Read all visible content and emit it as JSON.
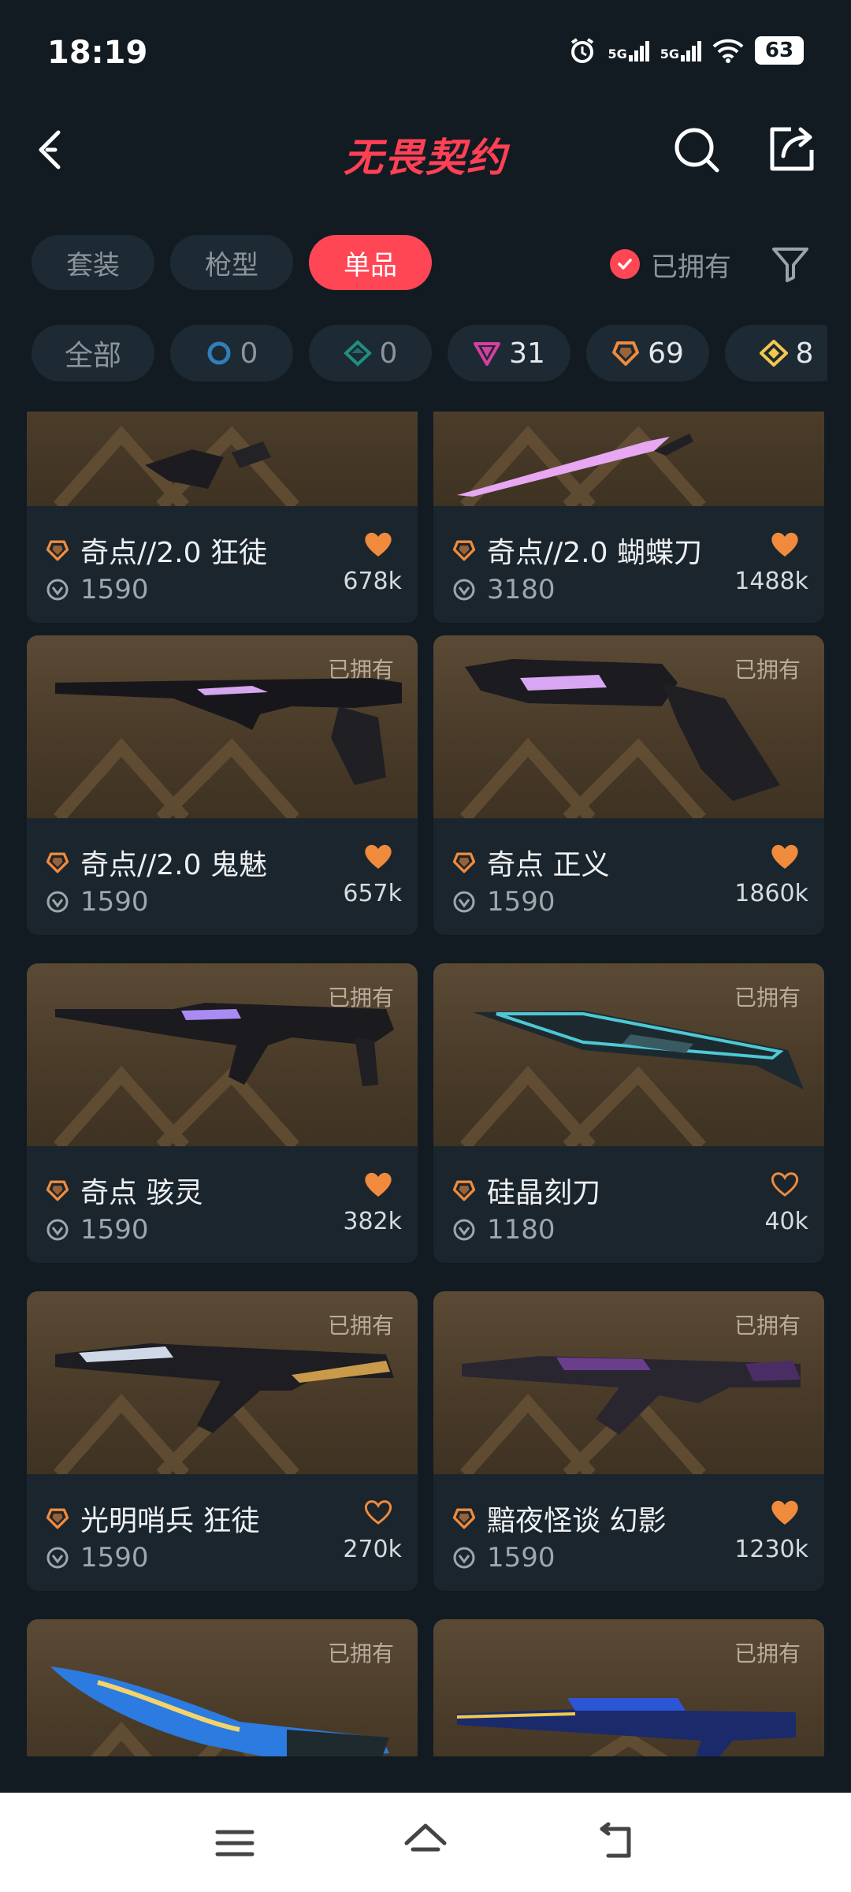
{
  "status": {
    "time": "18:19",
    "battery": "63",
    "signal1": "5G",
    "signal2": "5G"
  },
  "header": {
    "title": "无畏契约"
  },
  "tabs": [
    {
      "label": "套装",
      "active": false
    },
    {
      "label": "枪型",
      "active": false
    },
    {
      "label": "单品",
      "active": true
    }
  ],
  "owned_filter": {
    "label": "已拥有",
    "checked": true
  },
  "rarity_chips": [
    {
      "label": "全部",
      "icon": ""
    },
    {
      "label": "0",
      "icon": "select-tier-icon",
      "color": "#2f7fb8"
    },
    {
      "label": "0",
      "icon": "deluxe-tier-icon",
      "color": "#1f8f82"
    },
    {
      "label": "31",
      "icon": "premium-tier-icon",
      "color": "#d63ea0"
    },
    {
      "label": "69",
      "icon": "exclusive-tier-icon",
      "color": "#f08a3c"
    },
    {
      "label": "8",
      "icon": "ultra-tier-icon",
      "color": "#f2c94c"
    }
  ],
  "items": [
    {
      "name": "奇点//2.0 狂徒",
      "price": "1590",
      "likes": "678k",
      "favorited": true,
      "owned": ""
    },
    {
      "name": "奇点//2.0 蝴蝶刀",
      "price": "3180",
      "likes": "1488k",
      "favorited": true,
      "owned": ""
    },
    {
      "name": "奇点//2.0 鬼魅",
      "price": "1590",
      "likes": "657k",
      "favorited": true,
      "owned": "已拥有"
    },
    {
      "name": "奇点 正义",
      "price": "1590",
      "likes": "1860k",
      "favorited": true,
      "owned": "已拥有"
    },
    {
      "name": "奇点 骇灵",
      "price": "1590",
      "likes": "382k",
      "favorited": true,
      "owned": "已拥有"
    },
    {
      "name": "硅晶刻刀",
      "price": "1180",
      "likes": "40k",
      "favorited": false,
      "owned": "已拥有"
    },
    {
      "name": "光明哨兵 狂徒",
      "price": "1590",
      "likes": "270k",
      "favorited": false,
      "owned": "已拥有"
    },
    {
      "name": "黯夜怪谈 幻影",
      "price": "1590",
      "likes": "1230k",
      "favorited": true,
      "owned": "已拥有"
    },
    {
      "name": "",
      "price": "",
      "likes": "",
      "favorited": false,
      "owned": "已拥有"
    },
    {
      "name": "",
      "price": "",
      "likes": "",
      "favorited": false,
      "owned": "已拥有"
    }
  ],
  "colors": {
    "accent": "#ff4655",
    "heart": "#f08a3c",
    "exclusive": "#f08a3c",
    "background": "#121b22"
  }
}
